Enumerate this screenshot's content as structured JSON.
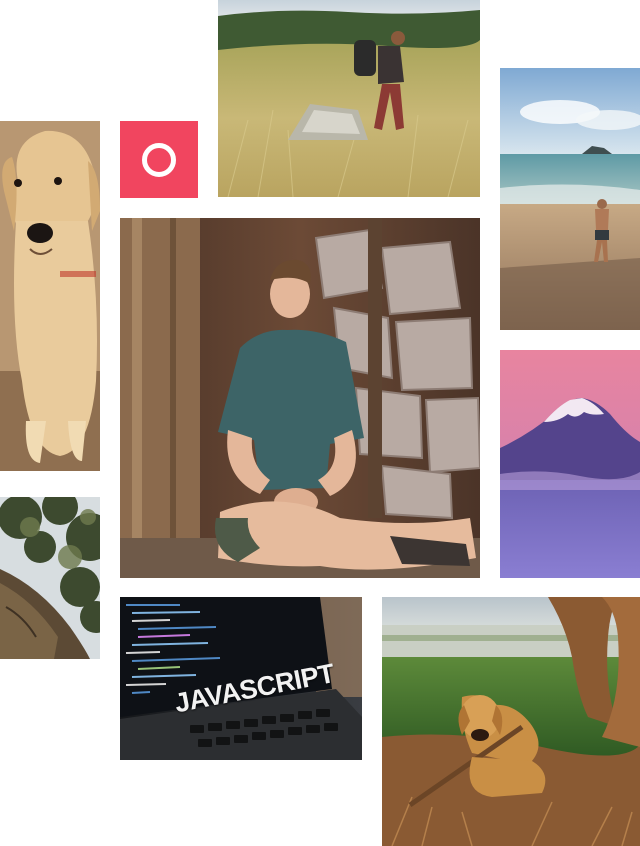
{
  "brand": {
    "logo_icon": "circle-ring-icon",
    "accent_color": "#f1455f",
    "icon_color": "#ffffff"
  },
  "photos": {
    "laptop": {
      "screen_text": "JAVASCRIPT"
    }
  }
}
